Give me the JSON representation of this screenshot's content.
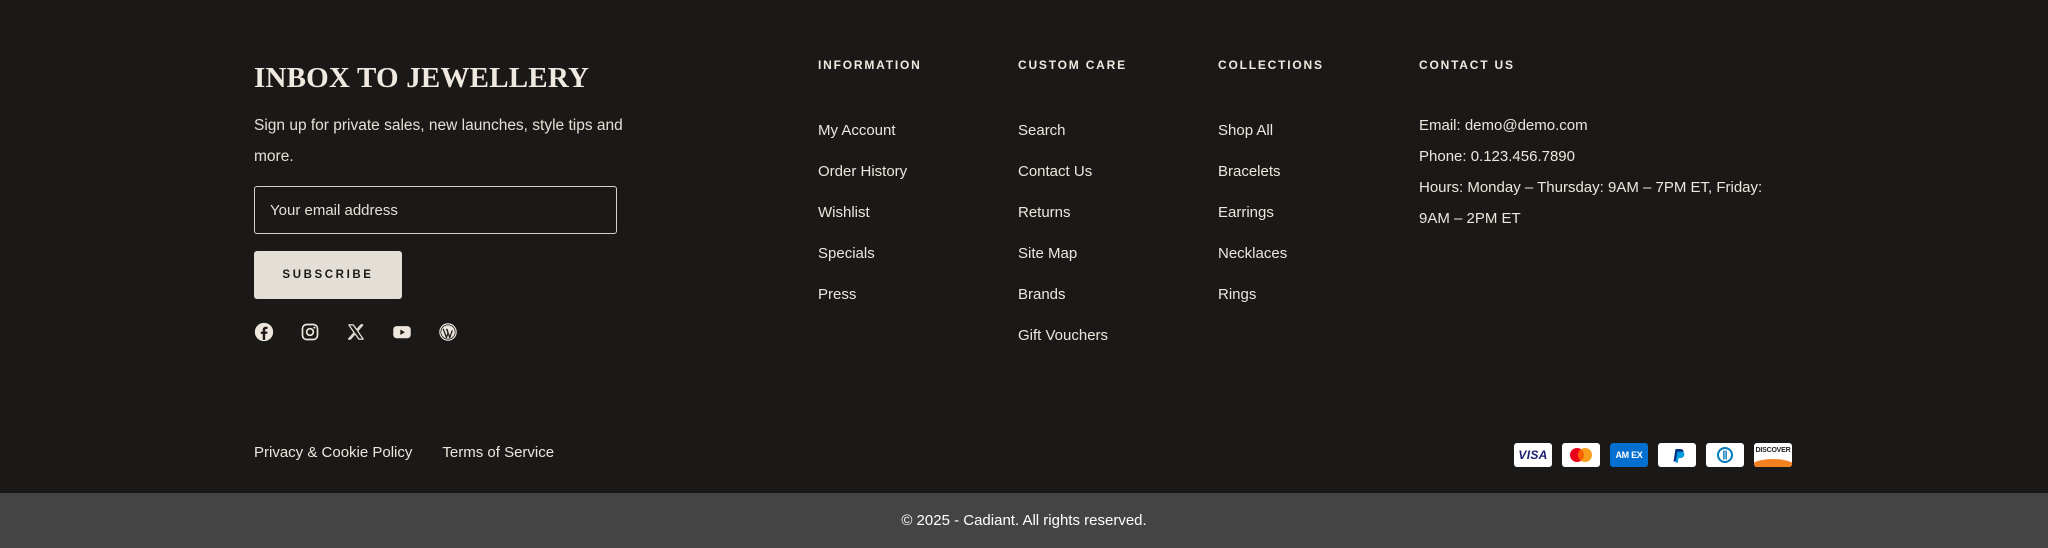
{
  "newsletter": {
    "title": "INBOX TO JEWELLERY",
    "description": "Sign up for private sales, new launches, style tips and more.",
    "email_placeholder": "Your email address",
    "subscribe_label": "SUBSCRIBE"
  },
  "socials": [
    "facebook-icon",
    "instagram-icon",
    "x-icon",
    "youtube-icon",
    "wordpress-icon"
  ],
  "columns": {
    "information": {
      "heading": "INFORMATION",
      "links": [
        "My Account",
        "Order History",
        "Wishlist",
        "Specials",
        "Press"
      ]
    },
    "custom_care": {
      "heading": "CUSTOM CARE",
      "links": [
        "Search",
        "Contact Us",
        "Returns",
        "Site Map",
        "Brands",
        "Gift Vouchers"
      ]
    },
    "collections": {
      "heading": "COLLECTIONS",
      "links": [
        "Shop All",
        "Bracelets",
        "Earrings",
        "Necklaces",
        "Rings"
      ]
    },
    "contact": {
      "heading": "CONTACT US",
      "email": "Email: demo@demo.com",
      "phone": "Phone: 0.123.456.7890",
      "hours": "Hours: Monday – Thursday: 9AM – 7PM ET, Friday: 9AM – 2PM ET"
    }
  },
  "legal": {
    "privacy": "Privacy & Cookie Policy",
    "terms": "Terms of Service"
  },
  "payments": {
    "visa": "VISA",
    "amex": "AM EX",
    "discover": "DISCOVER"
  },
  "copyright": "© 2025 - Cadiant. All rights reserved.",
  "colors": {
    "background": "#1b1918",
    "bottom_bar": "#444444",
    "button": "#e4dfd6",
    "text": "#ece6dc"
  }
}
